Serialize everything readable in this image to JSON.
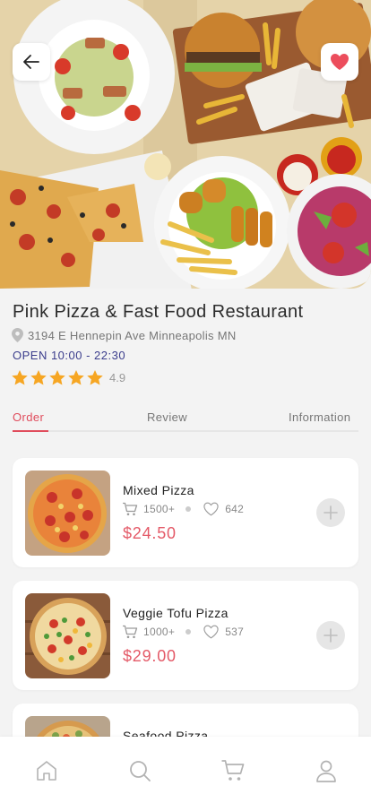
{
  "restaurant": {
    "name": "Pink Pizza & Fast Food Restaurant",
    "address": "3194 E Hennepin Ave Minneapolis MN",
    "hours": "OPEN 10:00 - 22:30",
    "rating": "4.9",
    "stars": 5,
    "favorited": true
  },
  "tabs": [
    {
      "label": "Order",
      "active": true
    },
    {
      "label": "Review",
      "active": false
    },
    {
      "label": "Information",
      "active": false
    }
  ],
  "menu": [
    {
      "name": "Mixed Pizza",
      "orders": "1500+",
      "likes": "642",
      "price": "$24.50"
    },
    {
      "name": "Veggie Tofu Pizza",
      "orders": "1000+",
      "likes": "537",
      "price": "$29.00"
    },
    {
      "name": "Seafood Pizza"
    }
  ],
  "nav": [
    "home-icon",
    "search-icon",
    "cart-icon",
    "profile-icon"
  ],
  "colors": {
    "accent": "#e04c5c",
    "price": "#e45a68",
    "hours": "#3b3d8c",
    "star": "#f6a623",
    "background": "#f3f3f3"
  }
}
